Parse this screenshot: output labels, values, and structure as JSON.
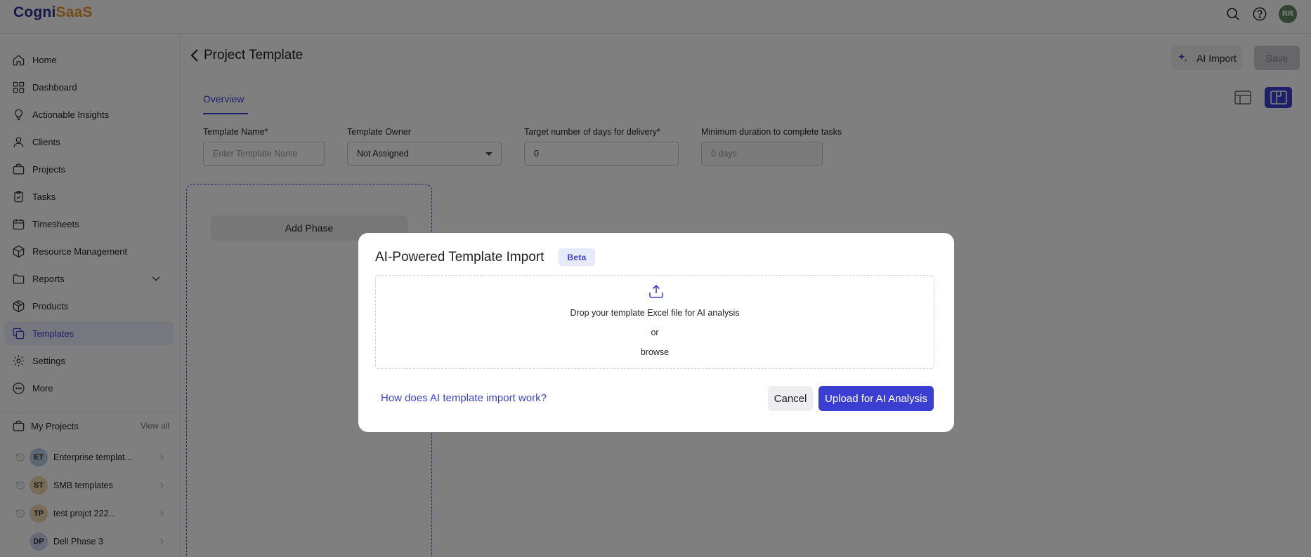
{
  "app": {
    "logo_part1": "Cogni",
    "logo_part2": "SaaS",
    "user_initials": "RR"
  },
  "sidebar": {
    "items": [
      {
        "label": "Home",
        "icon": "home-icon"
      },
      {
        "label": "Dashboard",
        "icon": "dashboard-icon"
      },
      {
        "label": "Actionable Insights",
        "icon": "lightbulb-icon"
      },
      {
        "label": "Clients",
        "icon": "user-icon"
      },
      {
        "label": "Projects",
        "icon": "briefcase-icon"
      },
      {
        "label": "Tasks",
        "icon": "clipboard-icon"
      },
      {
        "label": "Timesheets",
        "icon": "calendar-icon"
      },
      {
        "label": "Resource Management",
        "icon": "cube-icon"
      },
      {
        "label": "Reports",
        "icon": "folder-icon"
      },
      {
        "label": "Products",
        "icon": "box-icon"
      },
      {
        "label": "Templates",
        "icon": "copy-icon"
      },
      {
        "label": "Settings",
        "icon": "gear-icon"
      },
      {
        "label": "More",
        "icon": "more-icon"
      }
    ],
    "active": "Templates",
    "my_projects_label": "My Projects",
    "view_all_label": "View all",
    "projects": [
      {
        "initials": "ET",
        "name": "Enterprise templat...",
        "color": "#b9cfe8"
      },
      {
        "initials": "ST",
        "name": "SMB templates",
        "color": "#f0d7b0"
      },
      {
        "initials": "TP",
        "name": "test projct 222...",
        "color": "#f0d7b0"
      },
      {
        "initials": "DP",
        "name": "Dell Phase 3",
        "color": "#cfd3f5"
      }
    ]
  },
  "header": {
    "title": "Project Template",
    "ai_import_label": "AI Import",
    "save_label": "Save"
  },
  "tabs": {
    "overview": "Overview"
  },
  "form": {
    "template_name_label": "Template Name*",
    "template_name_placeholder": "Enter Template Name",
    "template_owner_label": "Template Owner",
    "template_owner_value": "Not Assigned",
    "target_days_label": "Target number of days for delivery*",
    "target_days_value": "0",
    "min_duration_label": "Minimum duration to complete tasks",
    "min_duration_value": "0 days"
  },
  "phase": {
    "add_phase_label": "Add Phase"
  },
  "modal": {
    "title": "AI-Powered Template Import",
    "badge": "Beta",
    "drop_text": "Drop your template Excel file for AI analysis",
    "or_text": "or",
    "browse_text": "browse",
    "help_link": "How does AI template import work?",
    "cancel_label": "Cancel",
    "upload_label": "Upload for AI Analysis"
  },
  "colors": {
    "accent": "#3b3fd1",
    "logo_primary": "#2b2f8c",
    "logo_secondary": "#e39a2a"
  }
}
